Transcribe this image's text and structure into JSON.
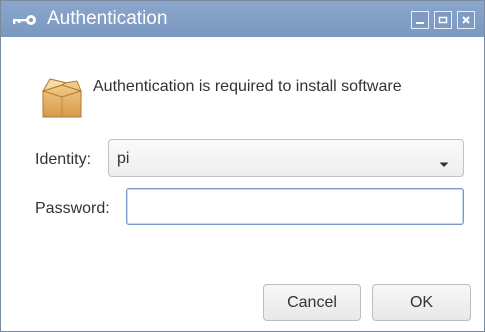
{
  "window": {
    "title": "Authentication",
    "title_icon": "key-icon",
    "accent": "#7b98c1"
  },
  "dialog": {
    "icon": "package-box-icon",
    "message": "Authentication is required to install software",
    "identity": {
      "label": "Identity:",
      "selected": "pi"
    },
    "password": {
      "label": "Password:",
      "value": ""
    },
    "buttons": {
      "cancel": "Cancel",
      "ok": "OK"
    }
  }
}
